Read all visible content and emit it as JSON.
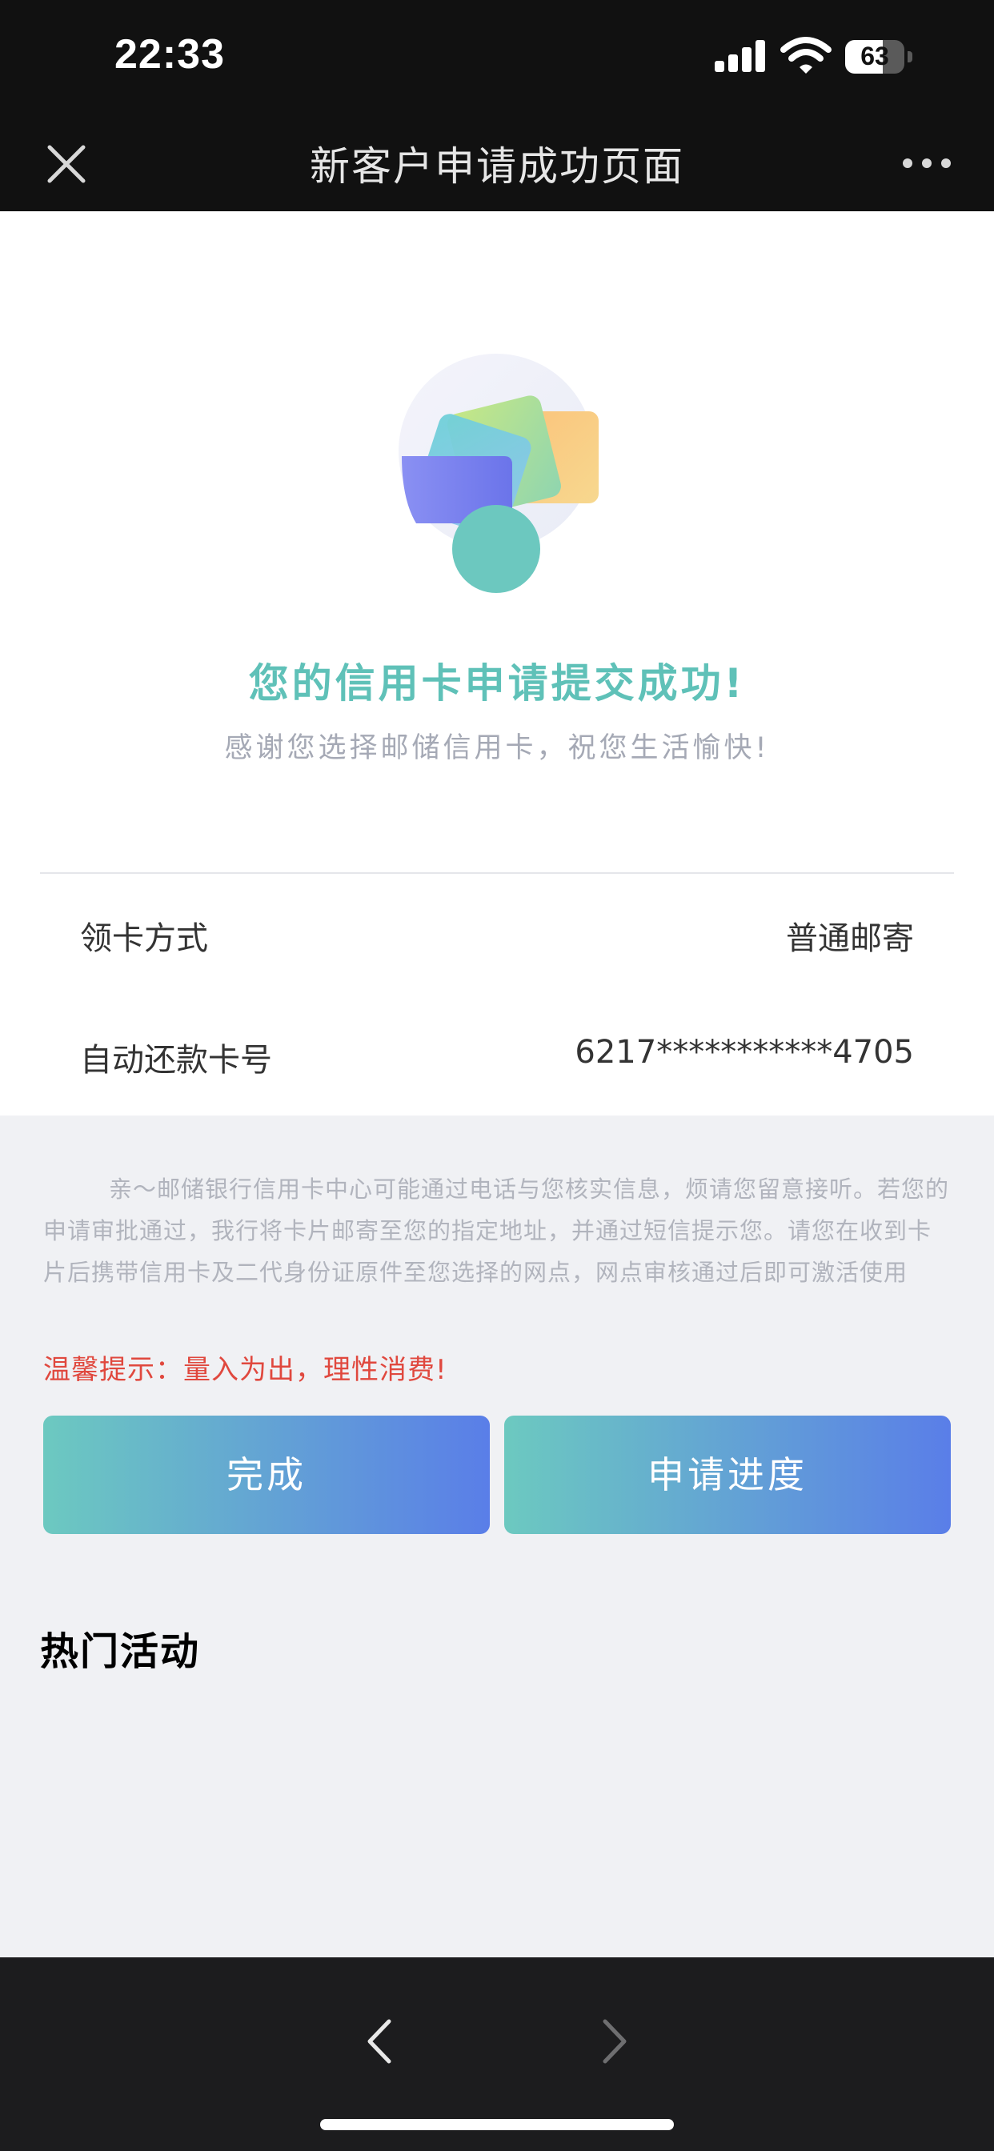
{
  "status_bar": {
    "time": "22:33",
    "battery_level": "63",
    "battery_fraction": 0.63
  },
  "nav": {
    "title": "新客户申请成功页面",
    "close_icon": "close-icon",
    "more_icon": "more-dots-icon"
  },
  "result": {
    "title": "您的信用卡申请提交成功!",
    "subtitle": "感谢您选择邮储信用卡，祝您生活愉快!"
  },
  "info_rows": [
    {
      "label": "领卡方式",
      "value": "普通邮寄"
    },
    {
      "label": "自动还款卡号",
      "value": "6217***********4705"
    }
  ],
  "notice": "亲～邮储银行信用卡中心可能通过电话与您核实信息，烦请您留意接听。若您的申请审批通过，我行将卡片邮寄至您的指定地址，并通过短信提示您。请您在收到卡片后携带信用卡及二代身份证原件至您选择的网点，网点审核通过后即可激活使用",
  "tip": "温馨提示：量入为出，理性消费!",
  "buttons": {
    "done": "完成",
    "progress": "申请进度"
  },
  "hot_section": {
    "title": "热门活动"
  },
  "colors": {
    "accent": "#5fc1b8",
    "tip": "#e0483e",
    "button_gradient_start": "#6cc9c0",
    "button_gradient_end": "#5a7ee8"
  }
}
